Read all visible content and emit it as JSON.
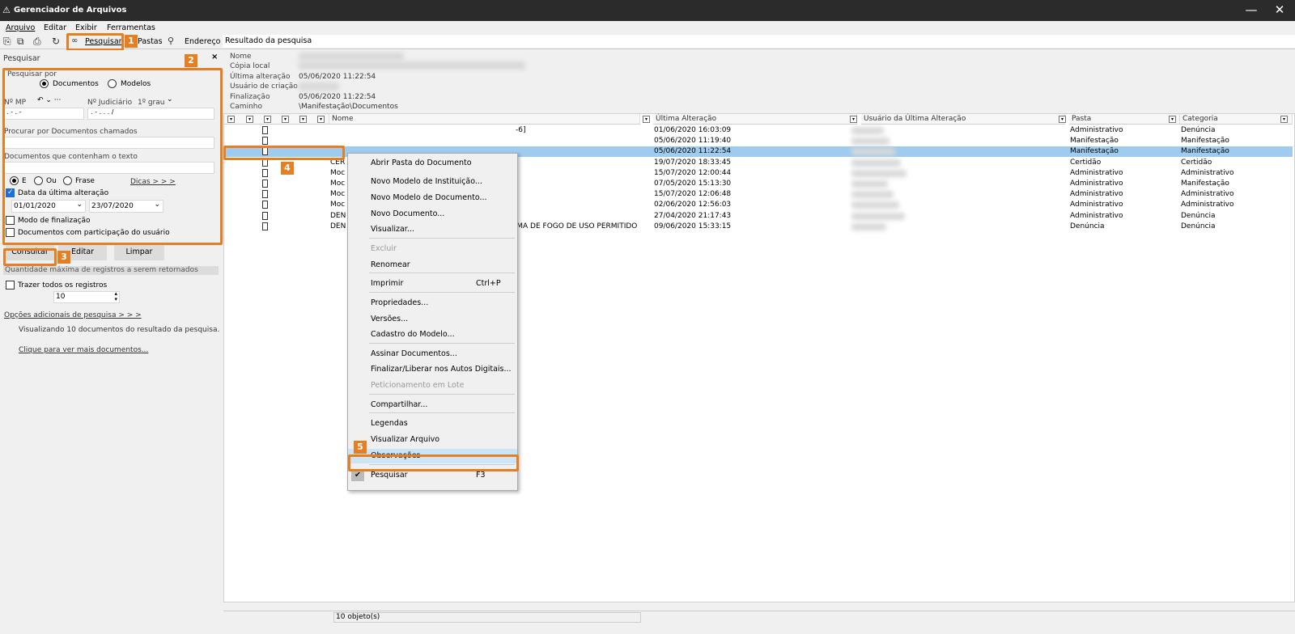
{
  "window": {
    "title": "Gerenciador de Arquivos",
    "minimize": "—",
    "close": "✕"
  },
  "menu": [
    "Arquivo",
    "Editar",
    "Exibir",
    "Ferramentas"
  ],
  "toolbar": {
    "search_label": "Pesquisar",
    "folders_label": "Pastas",
    "address_label": "Endereço",
    "address_value": "Resultado da pesquisa"
  },
  "badges": [
    "1",
    "2",
    "3",
    "4",
    "5"
  ],
  "search_panel": {
    "title": "Pesquisar",
    "search_by_label": "Pesquisar por",
    "opt_documents": "Documentos",
    "opt_models": "Modelos",
    "mp_label": "Nº MP",
    "judicial_label": "Nº Judiciário",
    "degree": "1º grau",
    "mp_value": ". - . -",
    "judicial_value": ". - . . . /",
    "name_label": "Procurar por Documentos chamados",
    "text_label": "Documentos que contenham o texto",
    "opt_and": "E",
    "opt_or": "Ou",
    "opt_phrase": "Frase",
    "tips": "Dicas > > >",
    "last_change_label": "Data da última alteração",
    "date_from": "01/01/2020",
    "date_to": "23/07/2020",
    "finalization_label": "Modo de finalização",
    "participation_label": "Documentos com participação do usuário",
    "btn_consult": "Consultar",
    "btn_edit": "Editar",
    "btn_clear": "Limpar",
    "max_records_label": "Quantidade máxima de registros a serem retornados",
    "bring_all_label": "Trazer todos os registros",
    "max_value": "10",
    "more_options": "Opções adicionais de pesquisa > > >",
    "info_text": "Visualizando 10 documentos do resultado da pesquisa.",
    "more_docs_link": "Clique para ver mais documentos..."
  },
  "details": {
    "k_name": "Nome",
    "k_local": "Cópia local",
    "k_last": "Última alteração",
    "v_last": "05/06/2020 11:22:54",
    "k_creator": "Usuário de criação",
    "k_final": "Finalização",
    "v_final": "05/06/2020 11:22:54",
    "k_path": "Caminho",
    "v_path": "\\Manifestação\\Documentos"
  },
  "grid": {
    "columns": [
      "Nome",
      "Última Alteração",
      "Usuário da Última Alteração",
      "Pasta",
      "Categoria"
    ],
    "rows": [
      {
        "name": "-6]",
        "date": "01/06/2020 16:03:09",
        "folder": "Administrativo",
        "category": "Denúncia"
      },
      {
        "name": "",
        "date": "05/06/2020 11:19:40",
        "folder": "Manifestação",
        "category": "Manifestação"
      },
      {
        "name": "",
        "date": "05/06/2020 11:22:54",
        "folder": "Manifestação",
        "category": "Manifestação"
      },
      {
        "name": "CER",
        "date": "19/07/2020 18:33:45",
        "folder": "Certidão",
        "category": "Certidão"
      },
      {
        "name": "Moc",
        "date": "15/07/2020 12:00:44",
        "folder": "Administrativo",
        "category": "Administrativo"
      },
      {
        "name": "Moc",
        "date": "07/05/2020 15:13:30",
        "folder": "Administrativo",
        "category": "Manifestação"
      },
      {
        "name": "Moc",
        "date": "15/07/2020 12:06:48",
        "folder": "Administrativo",
        "category": "Administrativo"
      },
      {
        "name": "Moc",
        "date": "02/06/2020 12:56:03",
        "folder": "Administrativo",
        "category": "Administrativo"
      },
      {
        "name": "DEN",
        "date": "27/04/2020 21:17:43",
        "folder": "Administrativo",
        "category": "Denúncia"
      },
      {
        "name": "DEN",
        "name_tail": "RMA DE FOGO DE USO PERMITIDO",
        "date": "09/06/2020 15:33:15",
        "folder": "Denúncia",
        "category": "Denúncia"
      }
    ]
  },
  "status": {
    "count": "10 objeto(s)"
  },
  "context_menu": [
    {
      "label": "Abrir Pasta do Documento"
    },
    {
      "label": "Novo Modelo de Instituição..."
    },
    {
      "label": "Novo Modelo de Documento..."
    },
    {
      "label": "Novo Documento..."
    },
    {
      "label": "Visualizar..."
    },
    {
      "label": "Excluir"
    },
    {
      "label": "Renomear"
    },
    {
      "label": "Imprimir",
      "shortcut": "Ctrl+P"
    },
    {
      "label": "Propriedades..."
    },
    {
      "label": "Versões..."
    },
    {
      "label": "Cadastro do Modelo..."
    },
    {
      "label": "Assinar Documentos..."
    },
    {
      "label": "Finalizar/Liberar nos Autos Digitais..."
    },
    {
      "label": "Peticionamento em Lote"
    },
    {
      "label": "Compartilhar..."
    },
    {
      "label": "Legendas"
    },
    {
      "label": "Visualizar Arquivo"
    },
    {
      "label": "Observações"
    },
    {
      "label": "Pesquisar",
      "shortcut": "F3"
    }
  ],
  "colors": {
    "accent": "#e67e22",
    "selection": "#9fcbee",
    "titlebar": "#2b2b2b"
  }
}
